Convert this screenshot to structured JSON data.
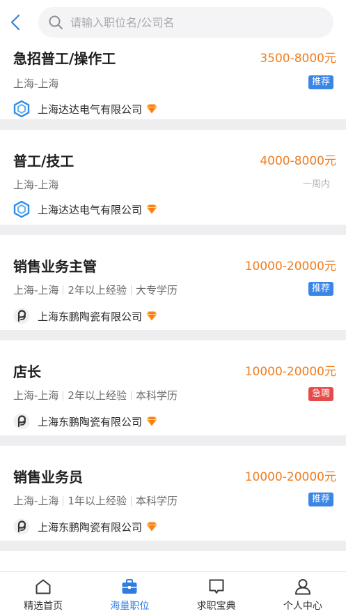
{
  "search": {
    "placeholder": "请输入职位名/公司名"
  },
  "jobs": [
    {
      "title": "急招普工/操作工",
      "salary": "3500-8000元",
      "location": "上海-上海",
      "experience": "",
      "education": "",
      "tag": "推荐",
      "tag_type": "rec",
      "company": "上海达达电气有限公司",
      "logo": "dada-logo-icon"
    },
    {
      "title": "普工/技工",
      "salary": "4000-8000元",
      "location": "上海-上海",
      "experience": "",
      "education": "",
      "tag": "一周内",
      "tag_type": "time",
      "company": "上海达达电气有限公司",
      "logo": "dada-logo-icon"
    },
    {
      "title": "销售业务主管",
      "salary": "10000-20000元",
      "location": "上海-上海",
      "experience": "2年以上经验",
      "education": "大专学历",
      "tag": "推荐",
      "tag_type": "rec",
      "company": "上海东鹏陶瓷有限公司",
      "logo": "dongpeng-logo-icon"
    },
    {
      "title": "店长",
      "salary": "10000-20000元",
      "location": "上海-上海",
      "experience": "2年以上经验",
      "education": "本科学历",
      "tag": "急聘",
      "tag_type": "urgent",
      "company": "上海东鹏陶瓷有限公司",
      "logo": "dongpeng-logo-icon"
    },
    {
      "title": "销售业务员",
      "salary": "10000-20000元",
      "location": "上海-上海",
      "experience": "1年以上经验",
      "education": "本科学历",
      "tag": "推荐",
      "tag_type": "rec",
      "company": "上海东鹏陶瓷有限公司",
      "logo": "dongpeng-logo-icon"
    }
  ],
  "nav": [
    {
      "label": "精选首页",
      "icon": "home-icon",
      "active": false
    },
    {
      "label": "海量职位",
      "icon": "briefcase-icon",
      "active": true
    },
    {
      "label": "求职宝典",
      "icon": "message-icon",
      "active": false
    },
    {
      "label": "个人中心",
      "icon": "user-icon",
      "active": false
    }
  ],
  "colors": {
    "accent": "#2f7de1",
    "salary": "#f07d1e",
    "tag_recommend": "#3a86e6",
    "tag_urgent": "#e84a4a",
    "separator": "#eeeef0"
  }
}
